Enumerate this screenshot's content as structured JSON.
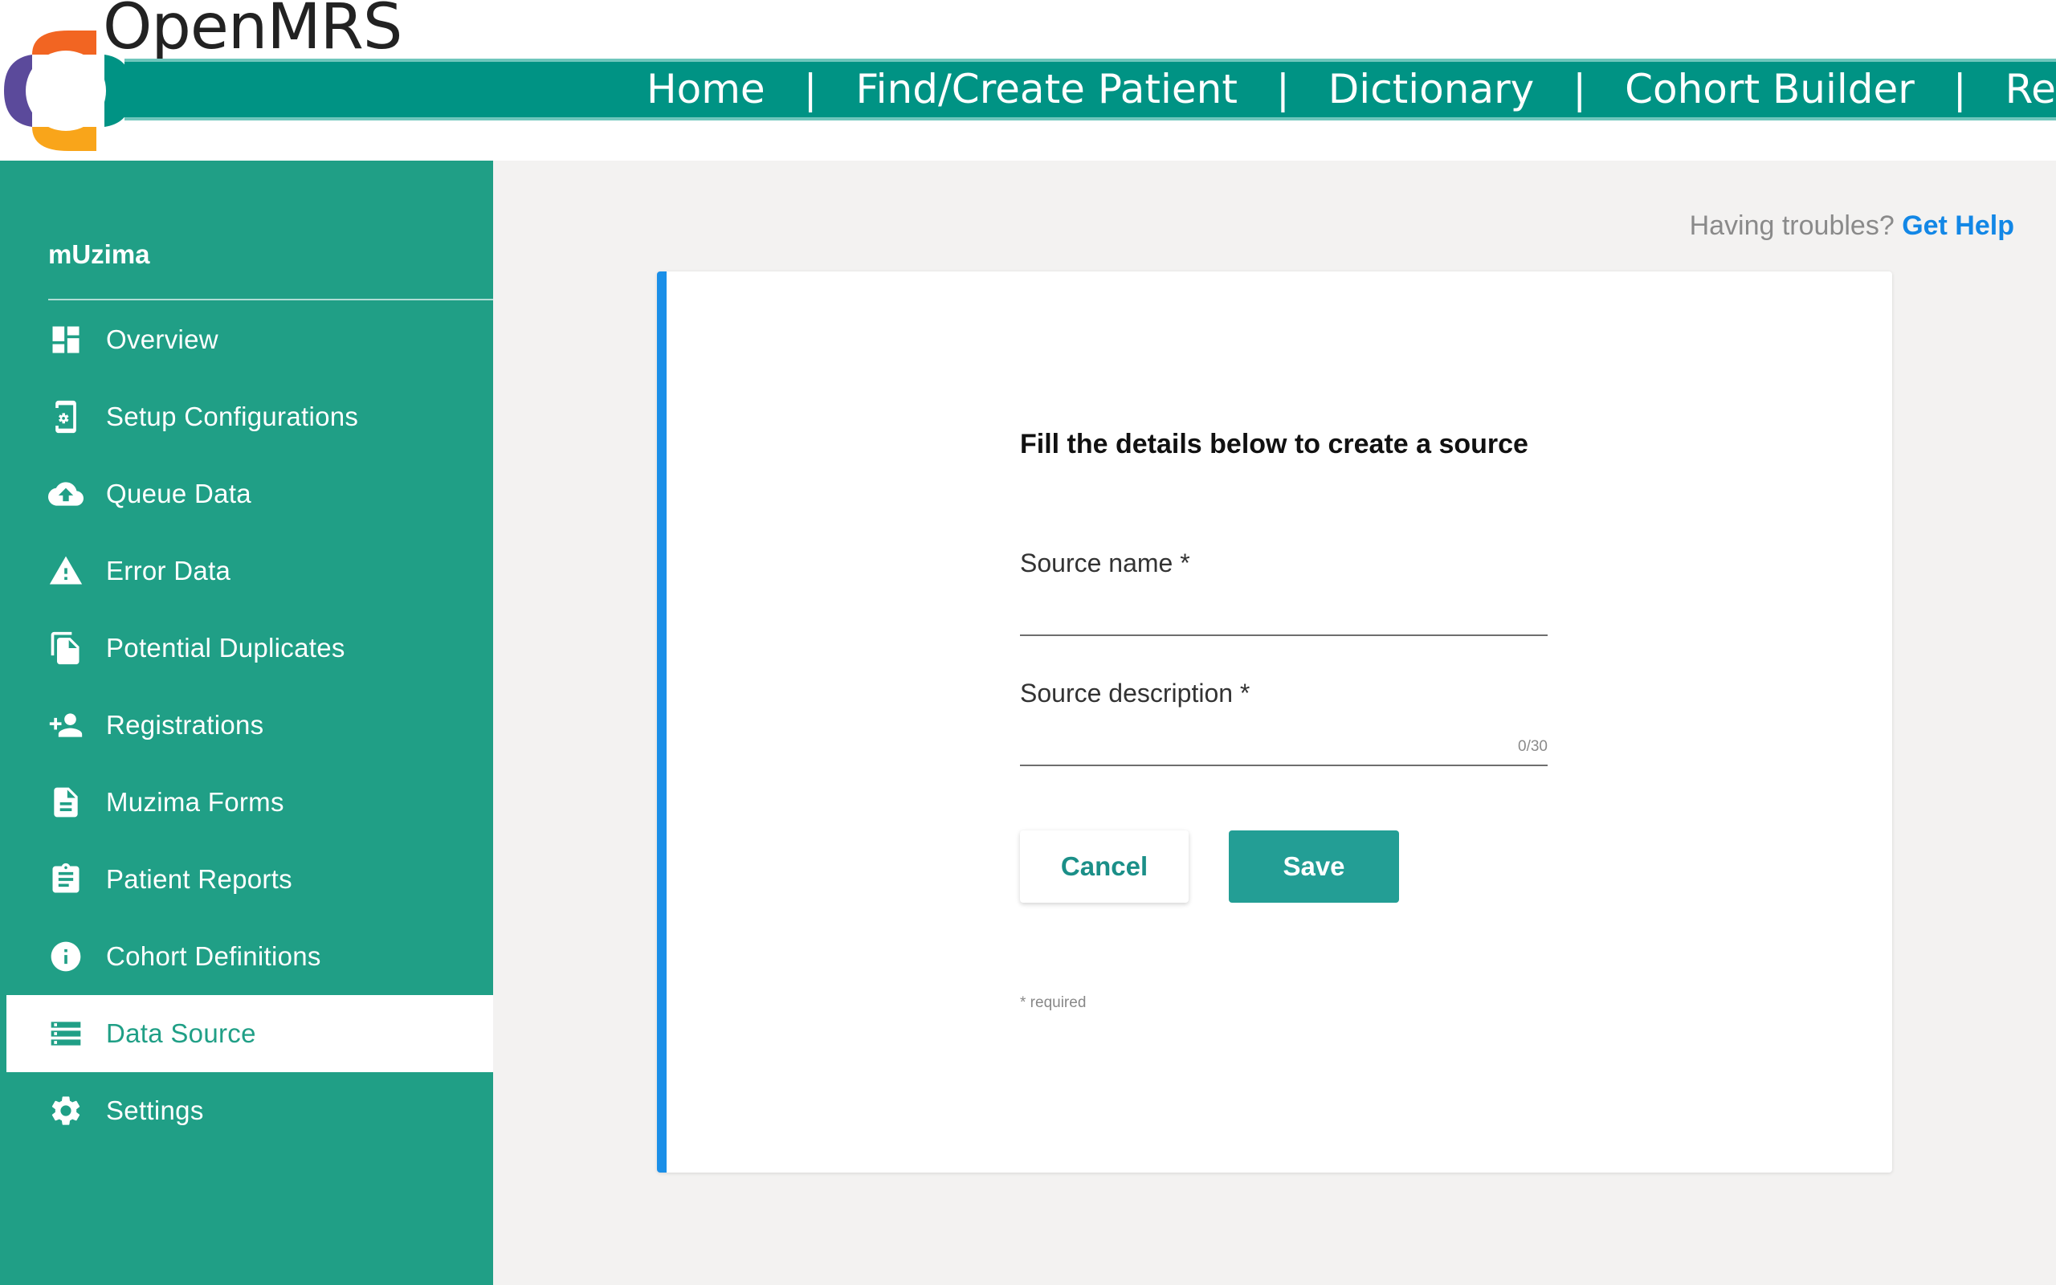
{
  "header": {
    "brand": "OpenMRS",
    "nav": [
      "Home",
      "Find/Create Patient",
      "Dictionary",
      "Cohort Builder",
      "Rep"
    ],
    "separator": "|"
  },
  "sidebar": {
    "title": "mUzima",
    "items": [
      {
        "label": "Overview",
        "icon": "dashboard-icon"
      },
      {
        "label": "Setup Configurations",
        "icon": "settings-phone-icon"
      },
      {
        "label": "Queue Data",
        "icon": "cloud-upload-icon"
      },
      {
        "label": "Error Data",
        "icon": "warning-icon"
      },
      {
        "label": "Potential Duplicates",
        "icon": "file-copy-icon"
      },
      {
        "label": "Registrations",
        "icon": "person-add-icon"
      },
      {
        "label": "Muzima Forms",
        "icon": "description-icon"
      },
      {
        "label": "Patient Reports",
        "icon": "assignment-icon"
      },
      {
        "label": "Cohort Definitions",
        "icon": "info-icon"
      },
      {
        "label": "Data Source",
        "icon": "storage-icon",
        "active": true
      },
      {
        "label": "Settings",
        "icon": "gear-icon"
      }
    ]
  },
  "help": {
    "prefix": "Having troubles?",
    "link": "Get Help"
  },
  "form": {
    "title": "Fill the details below to create a source",
    "source_name_label": "Source name *",
    "source_name_value": "",
    "source_description_label": "Source description *",
    "source_description_value": "",
    "description_counter": "0/30",
    "cancel_label": "Cancel",
    "save_label": "Save",
    "required_note": "* required"
  },
  "colors": {
    "sidebar_bg": "#209f86",
    "nav_bg": "#009384",
    "accent_blue": "#1a8fe8",
    "save_bg": "#239e95"
  }
}
